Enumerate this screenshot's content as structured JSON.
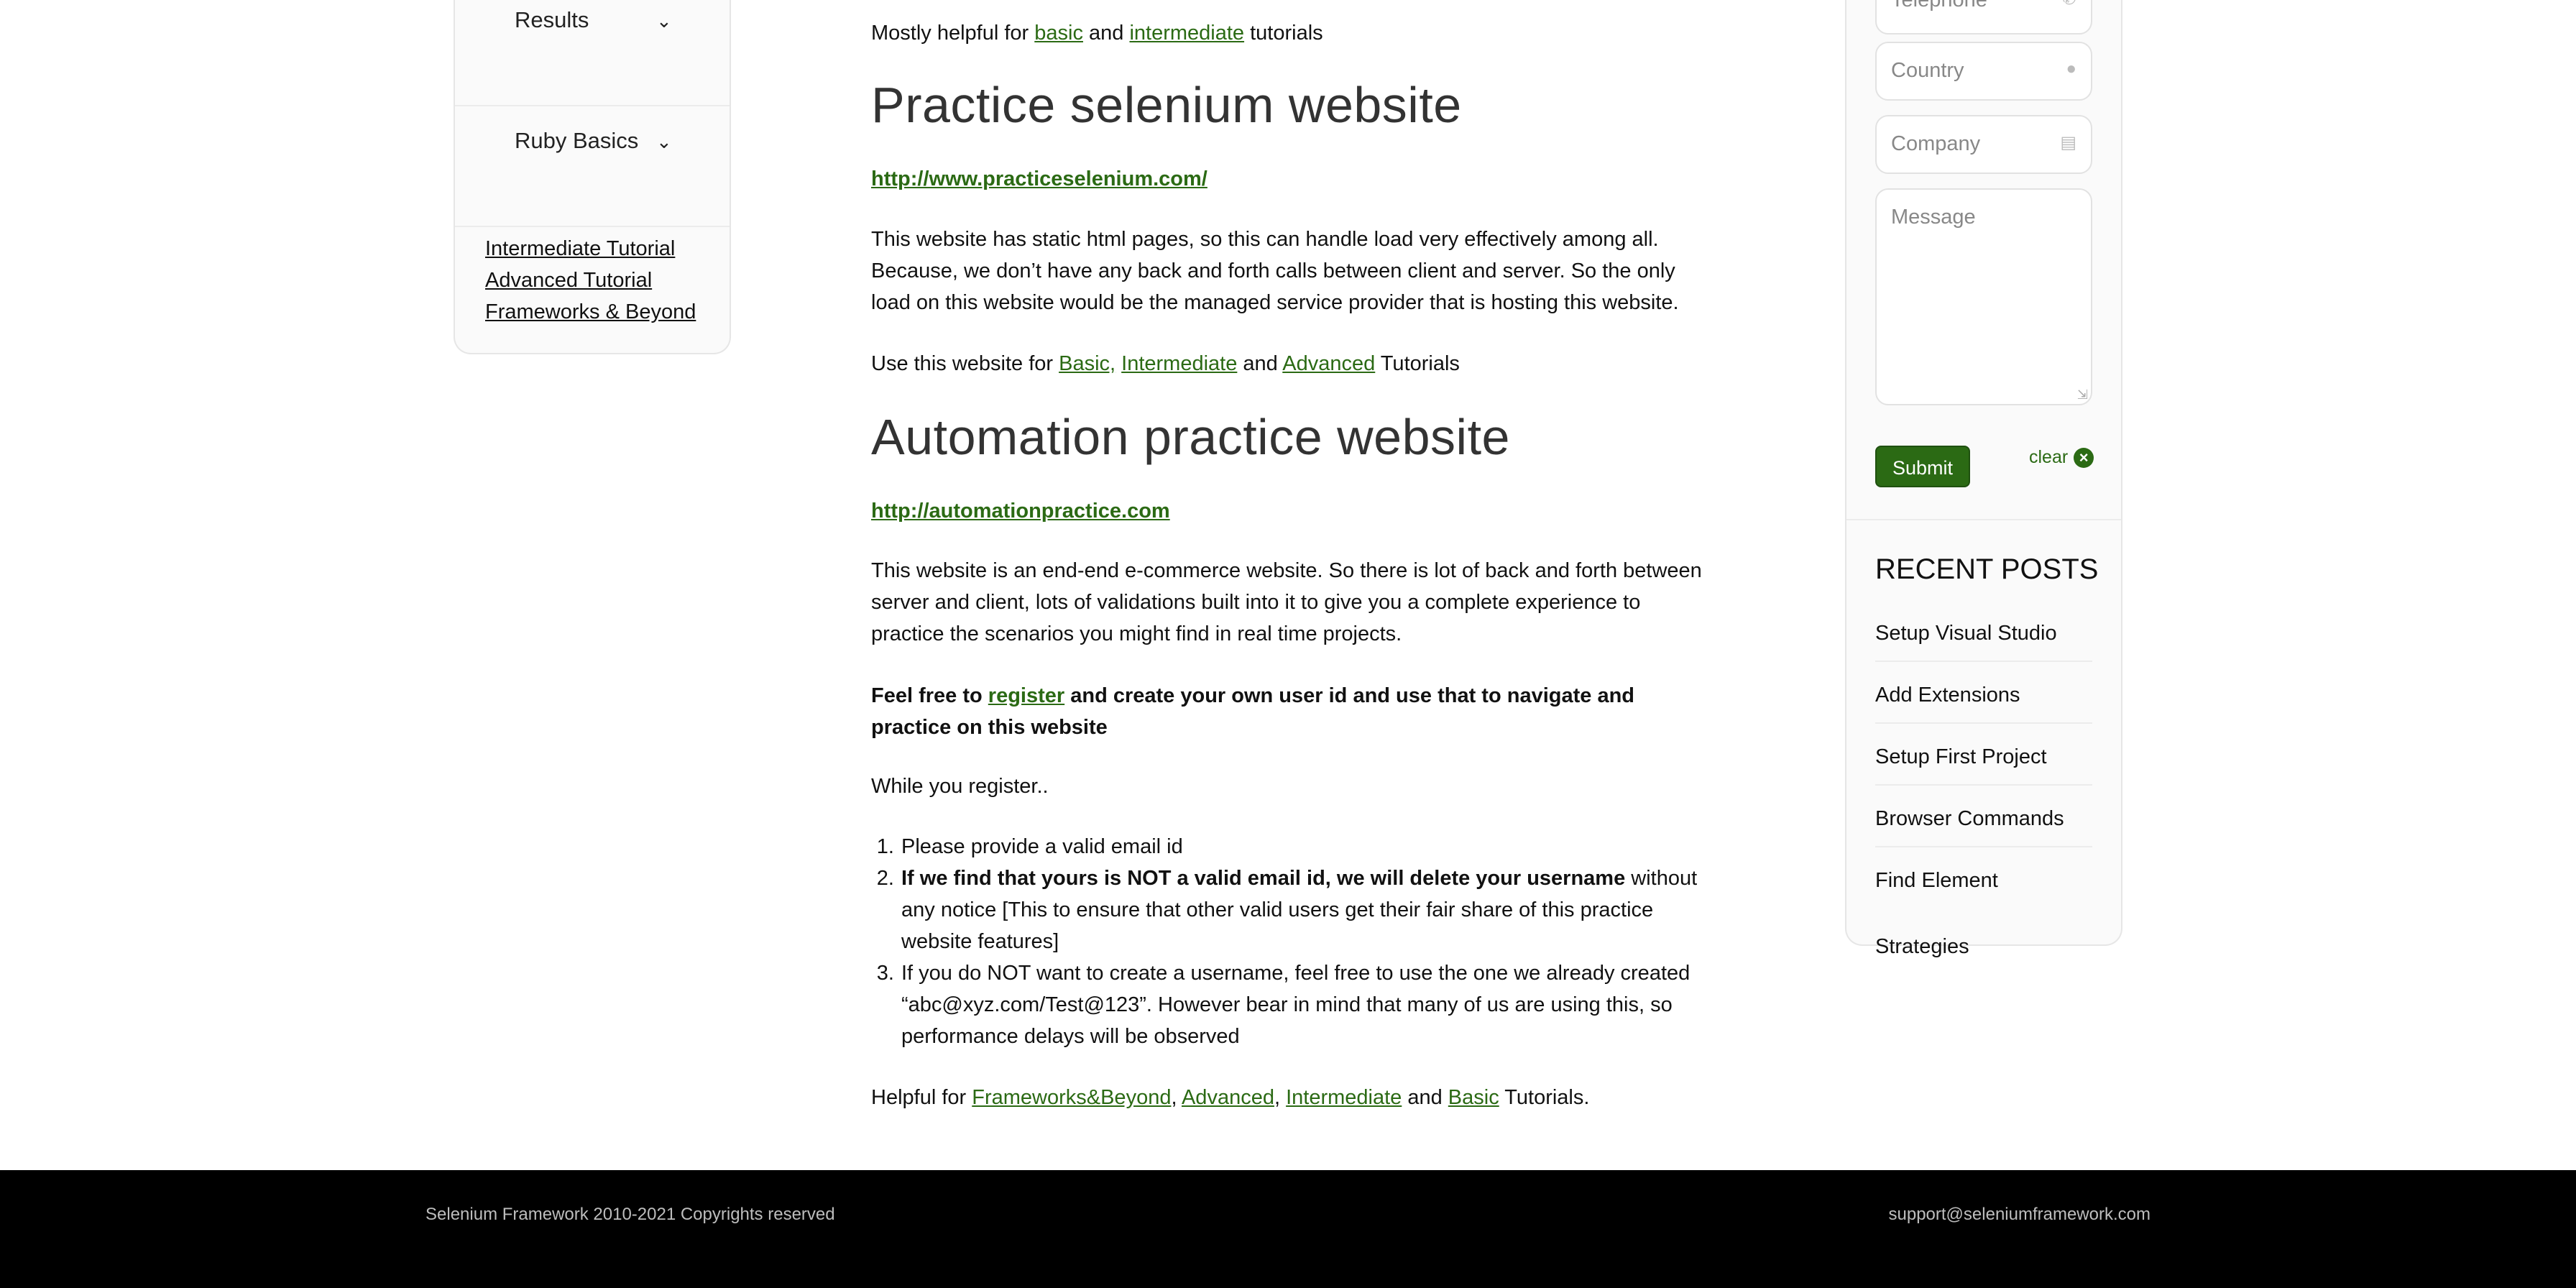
{
  "left_sidebar": {
    "accordion": [
      {
        "label": "Results"
      },
      {
        "label": "Ruby Basics"
      }
    ],
    "links": [
      "Intermediate Tutorial",
      "Advanced Tutorial",
      "Frameworks & Beyond"
    ]
  },
  "main": {
    "intro": {
      "prefix": "Mostly helpful for ",
      "link1": "basic",
      "and": " and ",
      "link2": "intermediate",
      "suffix": " tutorials"
    },
    "section1": {
      "title": "Practice selenium website",
      "url": "http://www.practiceselenium.com/",
      "description": "This website has static html pages, so this can handle load very effectively among all. Because, we don’t have any back and forth calls between client and server. So the only load on this website would be the managed service provider that is hosting this website.",
      "use_prefix": "Use this website for ",
      "use_link1": "Basic,",
      "use_link2": "Intermediate",
      "use_and": " and ",
      "use_link3": "Advanced",
      "use_suffix": " Tutorials"
    },
    "section2": {
      "title": "Automation practice website",
      "url": "http://automationpractice.com",
      "description": "This website is an end-end e-commerce website. So there is lot of back and forth between server and client, lots of validations built into it to give you a complete experience to practice the scenarios you might find in real time projects.",
      "register_prefix": "Feel free to ",
      "register_link": "register",
      "register_suffix": " and create your own user id and use that to navigate and practice on this website",
      "while": "While you register..",
      "list": [
        {
          "bold": "",
          "text": "Please provide a valid email id"
        },
        {
          "bold": "If we find that yours is NOT a valid email id, we will delete your username",
          "text": " without any notice [This to ensure that other valid users get their fair share of this practice website features]"
        },
        {
          "bold": "",
          "text": "If you do NOT want to create a username, feel free to use the one we already created “abc@xyz.com/Test@123”. However bear in mind that many of us are using this, so performance delays will be observed"
        }
      ],
      "helpful_prefix": "Helpful for ",
      "helpful_links": [
        "Frameworks&Beyond",
        "Advanced",
        "Intermediate",
        "Basic"
      ],
      "helpful_sep1": ", ",
      "helpful_sep2": ", ",
      "helpful_and": " and ",
      "helpful_suffix": " Tutorials."
    }
  },
  "contact_form": {
    "telephone_placeholder": "Telephone *",
    "country_placeholder": "Country",
    "company_placeholder": "Company",
    "message_placeholder": "Message",
    "submit_label": "Submit",
    "clear_label": "clear"
  },
  "recent_posts": {
    "title": "RECENT POSTS",
    "items": [
      "Setup Visual Studio",
      "Add Extensions",
      "Setup First Project",
      "Browser Commands",
      "Find Element Strategies"
    ]
  },
  "footer": {
    "copyright": "Selenium Framework 2010-2021 Copyrights reserved",
    "email": "support@seleniumframework.com"
  },
  "colors": {
    "link": "#2b6a14",
    "footer_bg": "#000000"
  }
}
